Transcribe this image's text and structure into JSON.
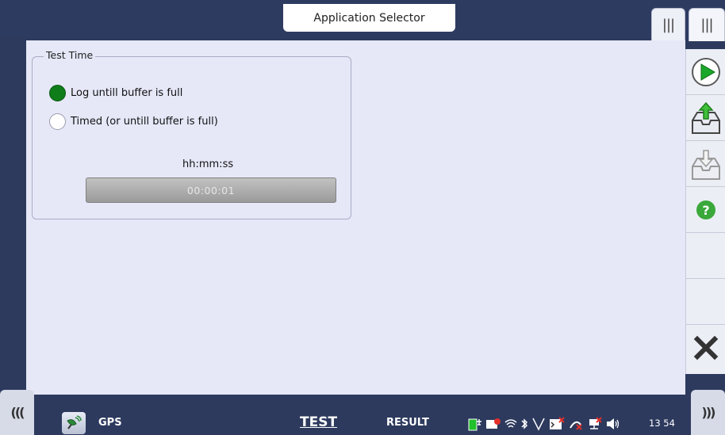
{
  "header": {
    "title": "Application Selector",
    "tabs": [
      "|||",
      "|||"
    ]
  },
  "test_time": {
    "group_title": "Test Time",
    "options": [
      {
        "label": "Log untill buffer is full",
        "selected": true
      },
      {
        "label": "Timed (or untill buffer is  full)",
        "selected": false
      }
    ],
    "format_label": "hh:mm:ss",
    "time_value": "00:00:01"
  },
  "sidebar": {
    "buttons": [
      "play-icon",
      "upload-icon",
      "download-icon",
      "help-icon",
      "",
      "",
      "close-icon"
    ],
    "help_label": "?"
  },
  "bottom": {
    "left_tab": "(((",
    "right_tab": ")))",
    "gps_label": "GPS",
    "tab_test": "TEST",
    "tab_result": "RESULT",
    "clock": "13 54"
  },
  "colors": {
    "accent_green": "#0f7d1a",
    "bar_bg": "#2d3a5e",
    "panel_bg": "#e6e8f8"
  }
}
